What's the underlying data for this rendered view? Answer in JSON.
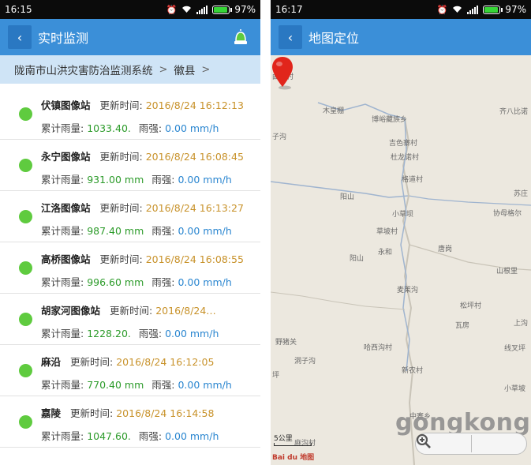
{
  "left": {
    "status": {
      "time": "16:15",
      "battery": "97%",
      "battery_level": 0.97
    },
    "appbar": {
      "back_icon": "chevron-left-icon",
      "title": "实时监测",
      "action_icon": "alarm-light-icon"
    },
    "breadcrumb": {
      "items": [
        "陇南市山洪灾害防治监测系统",
        "徽县"
      ],
      "separator": ">"
    },
    "labels": {
      "update": "更新时间:",
      "rain_total": "累计雨量:",
      "rain_intensity": "雨强:"
    },
    "stations": [
      {
        "name": "伏镇图像站",
        "time": "2016/8/24 16:12:13",
        "rain_total": "1033.40.",
        "rain_intensity": "0.00 mm/h"
      },
      {
        "name": "永宁图像站",
        "time": "2016/8/24 16:08:45",
        "rain_total": "931.00 mm",
        "rain_intensity": "0.00 mm/h"
      },
      {
        "name": "江洛图像站",
        "time": "2016/8/24 16:13:27",
        "rain_total": "987.40 mm",
        "rain_intensity": "0.00 mm/h"
      },
      {
        "name": "高桥图像站",
        "time": "2016/8/24 16:08:55",
        "rain_total": "996.60 mm",
        "rain_intensity": "0.00 mm/h"
      },
      {
        "name": "胡家河图像站",
        "time": "2016/8/24…",
        "rain_total": "1228.20.",
        "rain_intensity": "0.00 mm/h"
      },
      {
        "name": "麻沿",
        "time": "2016/8/24 16:12:05",
        "rain_total": "770.40 mm",
        "rain_intensity": "0.00 mm/h"
      },
      {
        "name": "嘉陵",
        "time": "2016/8/24 16:14:58",
        "rain_total": "1047.60.",
        "rain_intensity": "0.00 mm/h"
      }
    ],
    "colors": {
      "appbar": "#3b8fd8",
      "breadcrumb_bg": "#cfe4f6",
      "dot": "#5fcb3f",
      "time": "#c8922a",
      "rain_total": "#2c9b2a",
      "rain_intensity": "#2a86d0"
    }
  },
  "right": {
    "status": {
      "time": "16:17",
      "battery": "97%",
      "battery_level": 0.97
    },
    "appbar": {
      "back_icon": "chevron-left-icon",
      "title": "地图定位"
    },
    "map": {
      "places": [
        "曲马村",
        "木皇棚",
        "博峪藏族乡",
        "齐八比诺",
        "子沟",
        "吉色寨村",
        "杜龙诺村",
        "格道村",
        "阳山",
        "苏庄",
        "小草坝",
        "协母格尔",
        "草坡村",
        "唐岗",
        "阳山",
        "永和",
        "山根里",
        "麦茱沟",
        "松坪村",
        "瓦房",
        "上沟",
        "野猪关",
        "哈西沟村",
        "线叉坪",
        "洞子沟",
        "坪",
        "新农村",
        "小草坡",
        "中寨乡",
        "麻沟村"
      ],
      "scale_label": "5公里",
      "logo": "Bai du 地图",
      "watermark": "gongkong",
      "zoom_out_icon": "zoom-out-icon",
      "zoom_in_icon": "zoom-in-icon",
      "marker_icon": "map-pin-icon"
    }
  }
}
